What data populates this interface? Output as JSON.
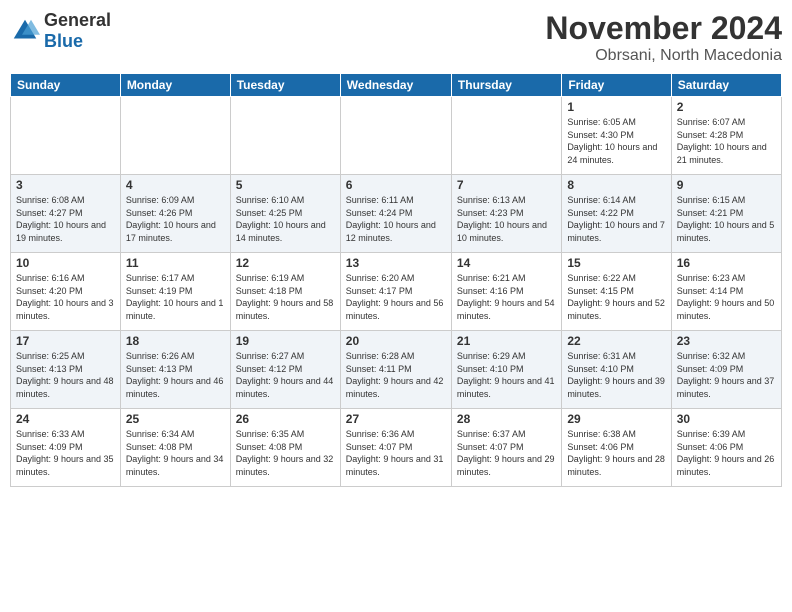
{
  "logo": {
    "general": "General",
    "blue": "Blue"
  },
  "header": {
    "month": "November 2024",
    "location": "Obrsani, North Macedonia"
  },
  "days_of_week": [
    "Sunday",
    "Monday",
    "Tuesday",
    "Wednesday",
    "Thursday",
    "Friday",
    "Saturday"
  ],
  "weeks": [
    [
      {
        "day": "",
        "info": ""
      },
      {
        "day": "",
        "info": ""
      },
      {
        "day": "",
        "info": ""
      },
      {
        "day": "",
        "info": ""
      },
      {
        "day": "",
        "info": ""
      },
      {
        "day": "1",
        "info": "Sunrise: 6:05 AM\nSunset: 4:30 PM\nDaylight: 10 hours and 24 minutes."
      },
      {
        "day": "2",
        "info": "Sunrise: 6:07 AM\nSunset: 4:28 PM\nDaylight: 10 hours and 21 minutes."
      }
    ],
    [
      {
        "day": "3",
        "info": "Sunrise: 6:08 AM\nSunset: 4:27 PM\nDaylight: 10 hours and 19 minutes."
      },
      {
        "day": "4",
        "info": "Sunrise: 6:09 AM\nSunset: 4:26 PM\nDaylight: 10 hours and 17 minutes."
      },
      {
        "day": "5",
        "info": "Sunrise: 6:10 AM\nSunset: 4:25 PM\nDaylight: 10 hours and 14 minutes."
      },
      {
        "day": "6",
        "info": "Sunrise: 6:11 AM\nSunset: 4:24 PM\nDaylight: 10 hours and 12 minutes."
      },
      {
        "day": "7",
        "info": "Sunrise: 6:13 AM\nSunset: 4:23 PM\nDaylight: 10 hours and 10 minutes."
      },
      {
        "day": "8",
        "info": "Sunrise: 6:14 AM\nSunset: 4:22 PM\nDaylight: 10 hours and 7 minutes."
      },
      {
        "day": "9",
        "info": "Sunrise: 6:15 AM\nSunset: 4:21 PM\nDaylight: 10 hours and 5 minutes."
      }
    ],
    [
      {
        "day": "10",
        "info": "Sunrise: 6:16 AM\nSunset: 4:20 PM\nDaylight: 10 hours and 3 minutes."
      },
      {
        "day": "11",
        "info": "Sunrise: 6:17 AM\nSunset: 4:19 PM\nDaylight: 10 hours and 1 minute."
      },
      {
        "day": "12",
        "info": "Sunrise: 6:19 AM\nSunset: 4:18 PM\nDaylight: 9 hours and 58 minutes."
      },
      {
        "day": "13",
        "info": "Sunrise: 6:20 AM\nSunset: 4:17 PM\nDaylight: 9 hours and 56 minutes."
      },
      {
        "day": "14",
        "info": "Sunrise: 6:21 AM\nSunset: 4:16 PM\nDaylight: 9 hours and 54 minutes."
      },
      {
        "day": "15",
        "info": "Sunrise: 6:22 AM\nSunset: 4:15 PM\nDaylight: 9 hours and 52 minutes."
      },
      {
        "day": "16",
        "info": "Sunrise: 6:23 AM\nSunset: 4:14 PM\nDaylight: 9 hours and 50 minutes."
      }
    ],
    [
      {
        "day": "17",
        "info": "Sunrise: 6:25 AM\nSunset: 4:13 PM\nDaylight: 9 hours and 48 minutes."
      },
      {
        "day": "18",
        "info": "Sunrise: 6:26 AM\nSunset: 4:13 PM\nDaylight: 9 hours and 46 minutes."
      },
      {
        "day": "19",
        "info": "Sunrise: 6:27 AM\nSunset: 4:12 PM\nDaylight: 9 hours and 44 minutes."
      },
      {
        "day": "20",
        "info": "Sunrise: 6:28 AM\nSunset: 4:11 PM\nDaylight: 9 hours and 42 minutes."
      },
      {
        "day": "21",
        "info": "Sunrise: 6:29 AM\nSunset: 4:10 PM\nDaylight: 9 hours and 41 minutes."
      },
      {
        "day": "22",
        "info": "Sunrise: 6:31 AM\nSunset: 4:10 PM\nDaylight: 9 hours and 39 minutes."
      },
      {
        "day": "23",
        "info": "Sunrise: 6:32 AM\nSunset: 4:09 PM\nDaylight: 9 hours and 37 minutes."
      }
    ],
    [
      {
        "day": "24",
        "info": "Sunrise: 6:33 AM\nSunset: 4:09 PM\nDaylight: 9 hours and 35 minutes."
      },
      {
        "day": "25",
        "info": "Sunrise: 6:34 AM\nSunset: 4:08 PM\nDaylight: 9 hours and 34 minutes."
      },
      {
        "day": "26",
        "info": "Sunrise: 6:35 AM\nSunset: 4:08 PM\nDaylight: 9 hours and 32 minutes."
      },
      {
        "day": "27",
        "info": "Sunrise: 6:36 AM\nSunset: 4:07 PM\nDaylight: 9 hours and 31 minutes."
      },
      {
        "day": "28",
        "info": "Sunrise: 6:37 AM\nSunset: 4:07 PM\nDaylight: 9 hours and 29 minutes."
      },
      {
        "day": "29",
        "info": "Sunrise: 6:38 AM\nSunset: 4:06 PM\nDaylight: 9 hours and 28 minutes."
      },
      {
        "day": "30",
        "info": "Sunrise: 6:39 AM\nSunset: 4:06 PM\nDaylight: 9 hours and 26 minutes."
      }
    ]
  ]
}
